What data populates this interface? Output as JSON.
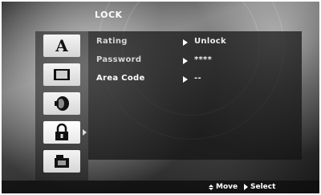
{
  "header": {
    "title": "LOCK"
  },
  "sidebar": {
    "items": [
      {
        "icon": "letter-a-icon",
        "label": "A"
      },
      {
        "icon": "screen-icon"
      },
      {
        "icon": "speaker-icon"
      },
      {
        "icon": "lock-icon",
        "active": true
      },
      {
        "icon": "folder-icon"
      }
    ]
  },
  "menu": {
    "rows": [
      {
        "label": "Rating",
        "value": "Unlock"
      },
      {
        "label": "Password",
        "value": "****"
      },
      {
        "label": "Area Code",
        "value": "--"
      }
    ]
  },
  "footer": {
    "move_label": "Move",
    "select_label": "Select"
  },
  "colors": {
    "highlight_text": "#ffffff",
    "normal_text": "#d8d8d8",
    "button_face": "#e6e6e6"
  }
}
